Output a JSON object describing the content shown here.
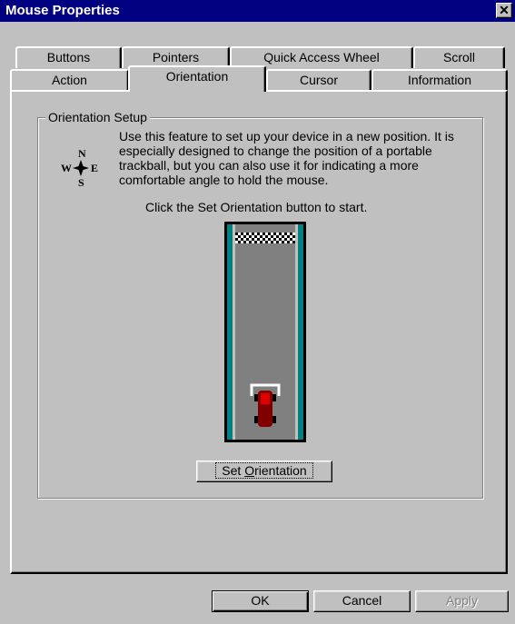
{
  "window": {
    "title": "Mouse Properties",
    "close_glyph": "✕"
  },
  "tabs": {
    "row_back": [
      {
        "label": "Buttons"
      },
      {
        "label": "Pointers"
      },
      {
        "label": "Quick Access Wheel"
      },
      {
        "label": "Scroll"
      }
    ],
    "row_front": [
      {
        "label": "Action"
      },
      {
        "label": "Orientation",
        "active": true
      },
      {
        "label": "Cursor"
      },
      {
        "label": "Information"
      }
    ]
  },
  "orientation": {
    "group_label": "Orientation Setup",
    "description": "Use this feature to set up your device in a new position. It is especially designed to change the position of a portable trackball, but you can also use it for indicating a more comfortable angle to hold the mouse.",
    "instruction": "Click the Set Orientation button to start.",
    "compass": {
      "n": "N",
      "s": "S",
      "w": "W",
      "e": "E",
      "icon": "compass-icon"
    },
    "track_colors": {
      "road": "#808080",
      "grass": "#008080",
      "car": "#800000"
    },
    "set_button": {
      "label_pre": "Set ",
      "label_key": "O",
      "label_post": "rientation"
    }
  },
  "buttons": {
    "ok": "OK",
    "cancel": "Cancel",
    "apply": "Apply"
  }
}
